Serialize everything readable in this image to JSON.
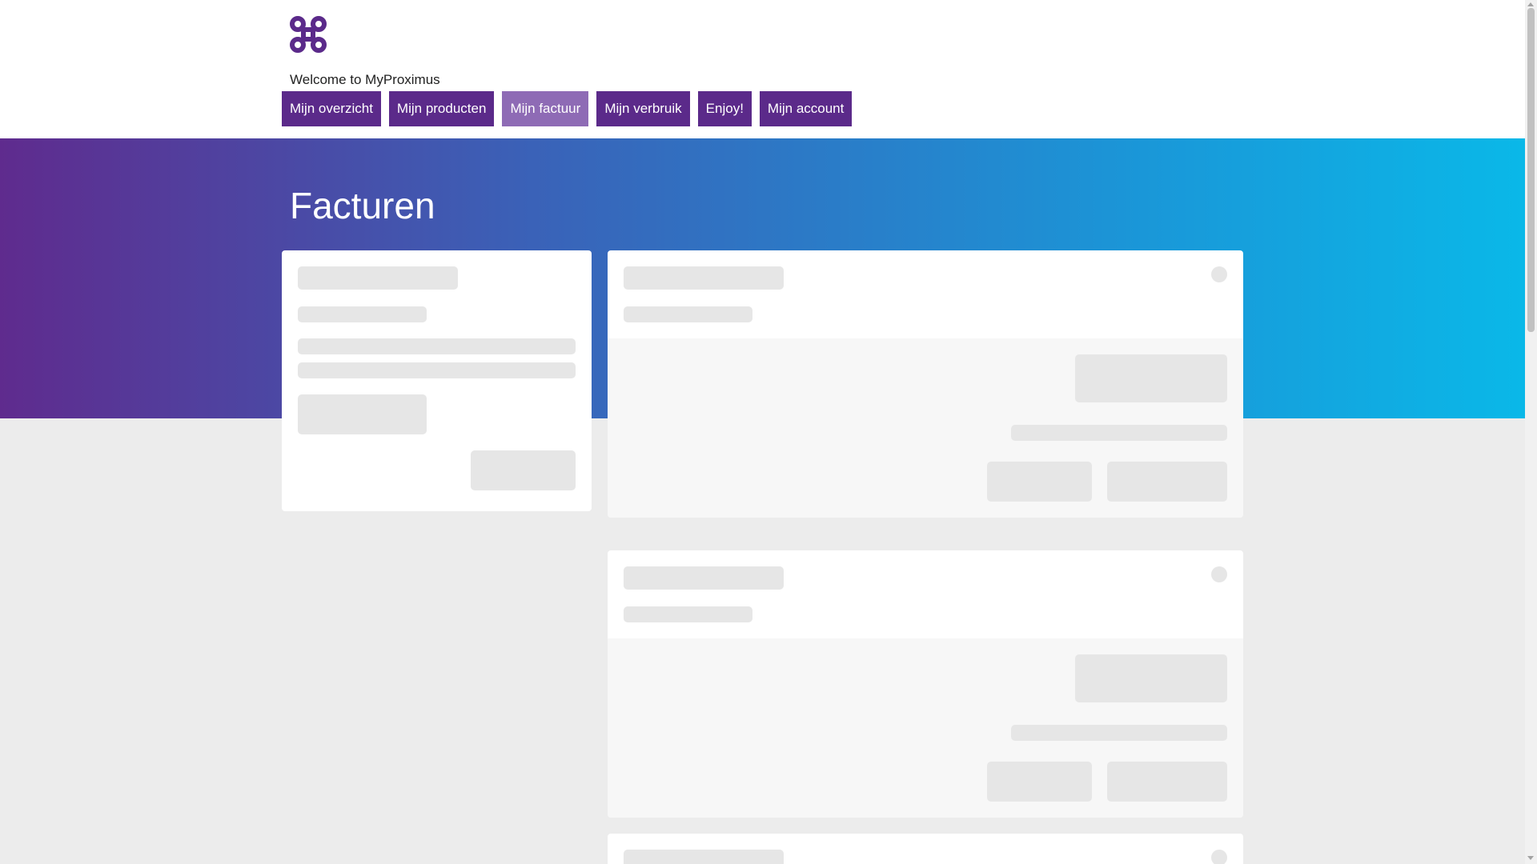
{
  "brand": {
    "logo_icon": "proximus-logo-icon",
    "logo_color": "#5b2a8a",
    "welcome_text": "Welcome to MyProximus"
  },
  "nav": {
    "items": [
      {
        "label": "Mijn overzicht",
        "active": false
      },
      {
        "label": "Mijn producten",
        "active": false
      },
      {
        "label": "Mijn factuur",
        "active": true
      },
      {
        "label": "Mijn verbruik",
        "active": false
      },
      {
        "label": "Enjoy!",
        "active": false
      },
      {
        "label": "Mijn account",
        "active": false
      }
    ]
  },
  "hero": {
    "title": "Facturen",
    "gradient_start": "#5f2b8e",
    "gradient_end": "#0ab8e8"
  },
  "state": {
    "loading": true
  },
  "colors": {
    "nav_bg": "#5b2a8a",
    "nav_active_bg": "#8e6bb5",
    "skeleton": "#e6e6e6",
    "page_bg": "#ececec"
  }
}
